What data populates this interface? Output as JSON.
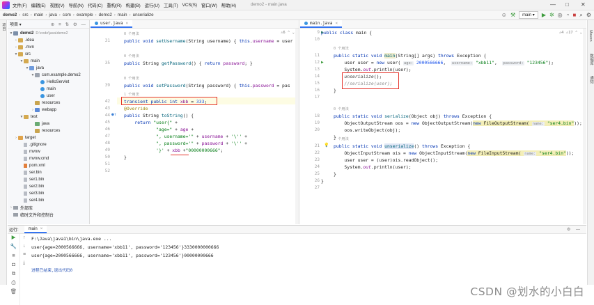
{
  "menubar": {
    "items": [
      "文件(F)",
      "编辑(E)",
      "视图(V)",
      "导航(N)",
      "代码(C)",
      "重构(R)",
      "构建(B)",
      "运行(U)",
      "工具(T)",
      "VCS(S)",
      "窗口(W)",
      "帮助(H)"
    ],
    "window_title": "demo2 - main.java",
    "controls": [
      "—",
      "□",
      "✕"
    ]
  },
  "navbar": {
    "crumbs": [
      "demo2",
      "src",
      "main",
      "java",
      "com",
      "example",
      "demo2",
      "main",
      "unserialize"
    ],
    "run_config": "main ▾"
  },
  "left_strip": {
    "label": "项目"
  },
  "right_strip": {
    "labels": [
      "Maven",
      "数据库",
      "通知"
    ]
  },
  "project": {
    "header": "项目 ▾",
    "tools": "⊕ ≡ ⇅ ⚙ —",
    "tree": [
      {
        "label": "demo2",
        "hint": "D:\\code\\java\\demo2",
        "icon": "module"
      },
      {
        "label": ".idea",
        "icon": "folder"
      },
      {
        "label": ".mvn",
        "icon": "folder"
      },
      {
        "label": "src",
        "icon": "folder"
      },
      {
        "label": "main",
        "icon": "folder"
      },
      {
        "label": "java",
        "icon": "folder-src"
      },
      {
        "label": "com.example.demo2",
        "icon": "package"
      },
      {
        "label": "HelloServlet",
        "icon": "class"
      },
      {
        "label": "main",
        "icon": "class"
      },
      {
        "label": "user",
        "icon": "class"
      },
      {
        "label": "resources",
        "icon": "folder-res"
      },
      {
        "label": "webapp",
        "icon": "folder-blue"
      },
      {
        "label": "test",
        "icon": "folder"
      },
      {
        "label": "java",
        "icon": "folder-test"
      },
      {
        "label": "resources",
        "icon": "folder-res"
      },
      {
        "label": "target",
        "icon": "folder-orange"
      },
      {
        "label": ".gitignore",
        "icon": "file"
      },
      {
        "label": "mvnw",
        "icon": "file"
      },
      {
        "label": "mvnw.cmd",
        "icon": "file"
      },
      {
        "label": "pom.xml",
        "icon": "xml"
      },
      {
        "label": "ser.bin",
        "icon": "file"
      },
      {
        "label": "ser1.bin",
        "icon": "file"
      },
      {
        "label": "ser2.bin",
        "icon": "file"
      },
      {
        "label": "ser3.bin",
        "icon": "file"
      },
      {
        "label": "ser4.bin",
        "icon": "file"
      },
      {
        "label": "外部库",
        "icon": "bar"
      },
      {
        "label": "临时文件和控制台",
        "icon": "bar"
      }
    ]
  },
  "editor_left": {
    "tab": "user.java",
    "badge": "⚠6 ⌃ ⌄",
    "lines": {
      "hint31": "0 个用法",
      "l31": "31",
      "hint35": "0 个用法",
      "l35": "35",
      "hint39": "0 个用法",
      "l39": "39",
      "hint42": "1 个用法",
      "l42": "42",
      "l43": "43",
      "l44": "44",
      "l45": "45",
      "l46": "46",
      "l47": "47",
      "l48": "48",
      "l49": "49",
      "l50": "50",
      "l51": "51",
      "l52": "52"
    }
  },
  "editor_right": {
    "tab": "main.java",
    "badge": "⚠4 ⚠17 ⌃ ⌄",
    "lines": {
      "l9": "9",
      "l10": "10",
      "hint11": "0 个用法",
      "l11": "11",
      "l12": "12",
      "l13": "13",
      "l14": "14",
      "l15": "15",
      "l16": "16",
      "l17": "17",
      "hint18": "0 个用法",
      "l18": "18",
      "l19": "19",
      "l20": "20",
      "hint21": "1 个用法",
      "l21": "21",
      "l22": "22",
      "l23": "23",
      "l24": "24",
      "l25": "25",
      "l26": "26",
      "l27": "27"
    }
  },
  "run": {
    "header": "运行:",
    "tab": "main",
    "tools": "⚙ —",
    "console": [
      "F:\\Java\\java1\\bin\\java.exe ...",
      "user{age=2000566666, username='xbb11', password='123456'}3330000000666",
      "user{age=2000566666, username='xbb11', password='123456'}00000000666",
      "",
      "进程已结束,退出代码0"
    ]
  },
  "watermark": "CSDN @划水的小白白"
}
